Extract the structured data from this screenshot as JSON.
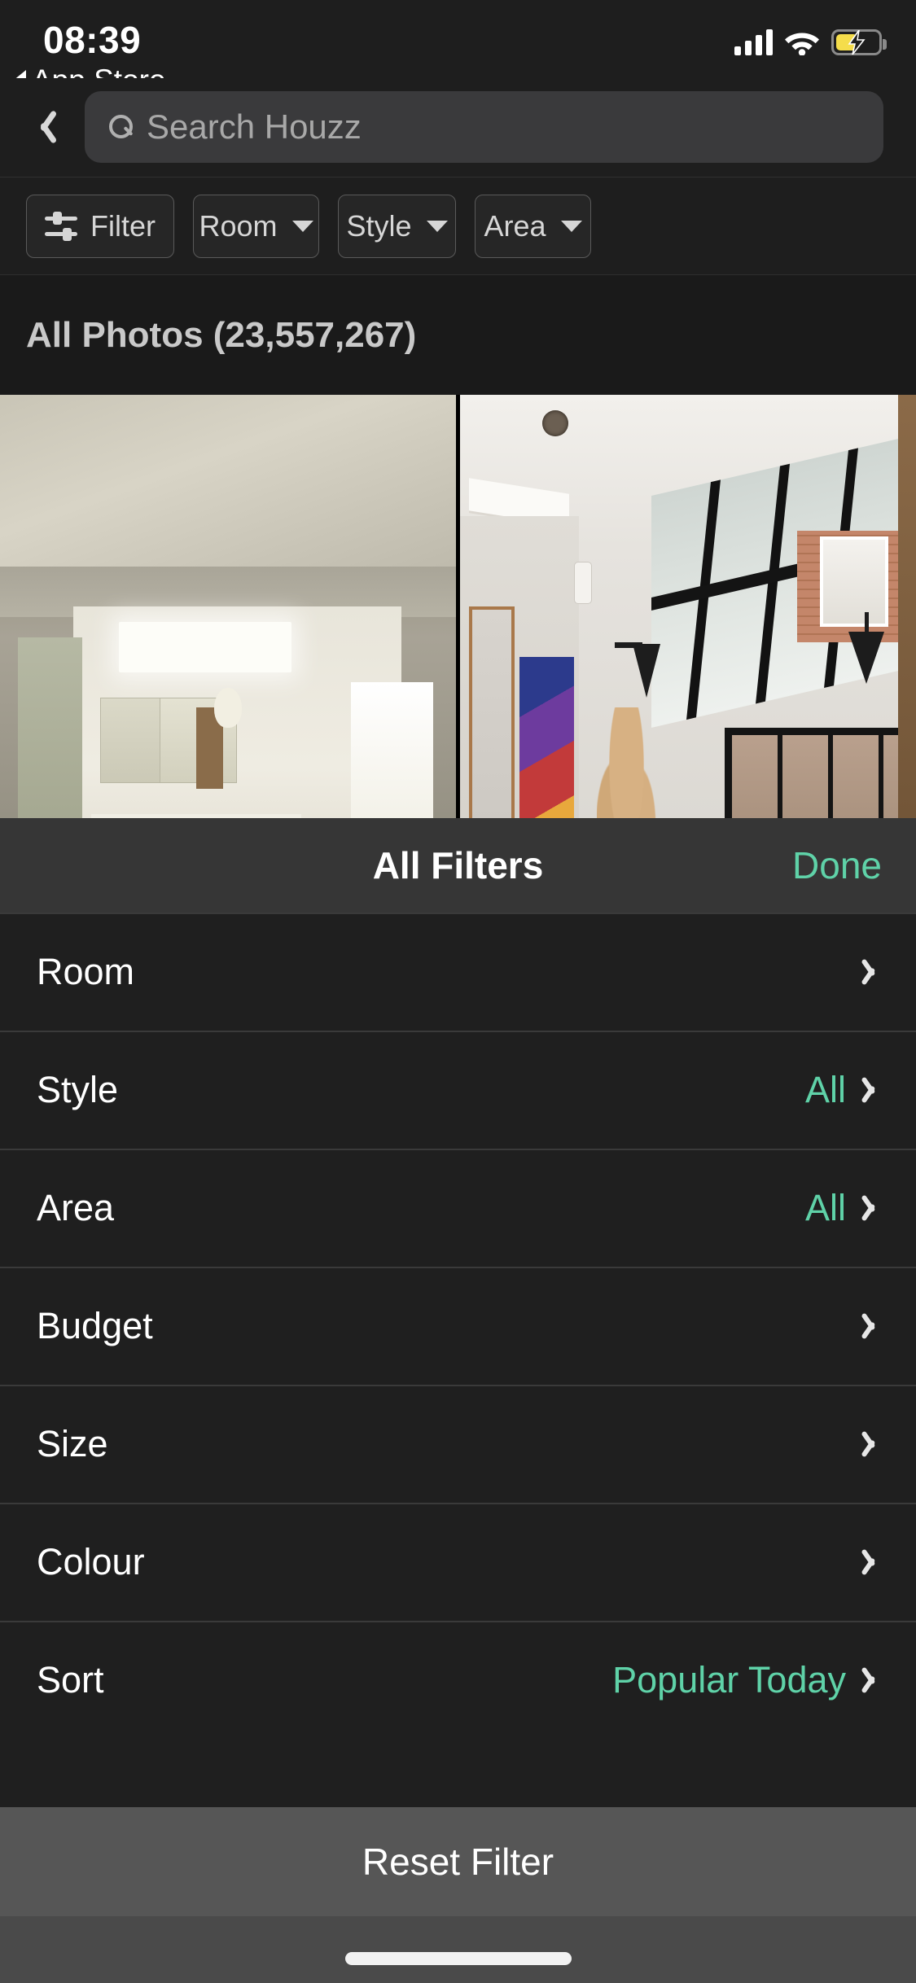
{
  "status_bar": {
    "time": "08:39",
    "back_app_label": "App Store",
    "icons": {
      "cellular": "signal-bars-icon",
      "wifi": "wifi-icon",
      "battery": "battery-charging-icon"
    },
    "battery_color": "#f5dd4b"
  },
  "nav": {
    "back_icon": "chevron-left-icon",
    "search_placeholder": "Search Houzz",
    "search_value": "",
    "search_icon": "search-icon"
  },
  "chips": [
    {
      "label": "Filter",
      "icon": "sliders-icon",
      "has_caret": false
    },
    {
      "label": "Room",
      "icon": "",
      "has_caret": true
    },
    {
      "label": "Style",
      "icon": "",
      "has_caret": true
    },
    {
      "label": "Area",
      "icon": "",
      "has_caret": true
    }
  ],
  "section": {
    "title": "All Photos (23,557,267)",
    "count": "23,557,267"
  },
  "photo_grid": {
    "items": [
      {
        "alt": "Cream kitchen with skylight and flowers"
      },
      {
        "alt": "Glass roof extension with black sconces"
      }
    ]
  },
  "filter_sheet": {
    "title": "All Filters",
    "done_label": "Done",
    "accent_color": "#5fd2a8",
    "rows": [
      {
        "label": "Room",
        "value": "",
        "chevron": "chevron-right-icon"
      },
      {
        "label": "Style",
        "value": "All",
        "chevron": "chevron-right-icon"
      },
      {
        "label": "Area",
        "value": "All",
        "chevron": "chevron-right-icon"
      },
      {
        "label": "Budget",
        "value": "",
        "chevron": "chevron-right-icon"
      },
      {
        "label": "Size",
        "value": "",
        "chevron": "chevron-right-icon"
      },
      {
        "label": "Colour",
        "value": "",
        "chevron": "chevron-right-icon"
      },
      {
        "label": "Sort",
        "value": "Popular Today",
        "chevron": "chevron-right-icon"
      }
    ],
    "reset_label": "Reset Filter"
  }
}
